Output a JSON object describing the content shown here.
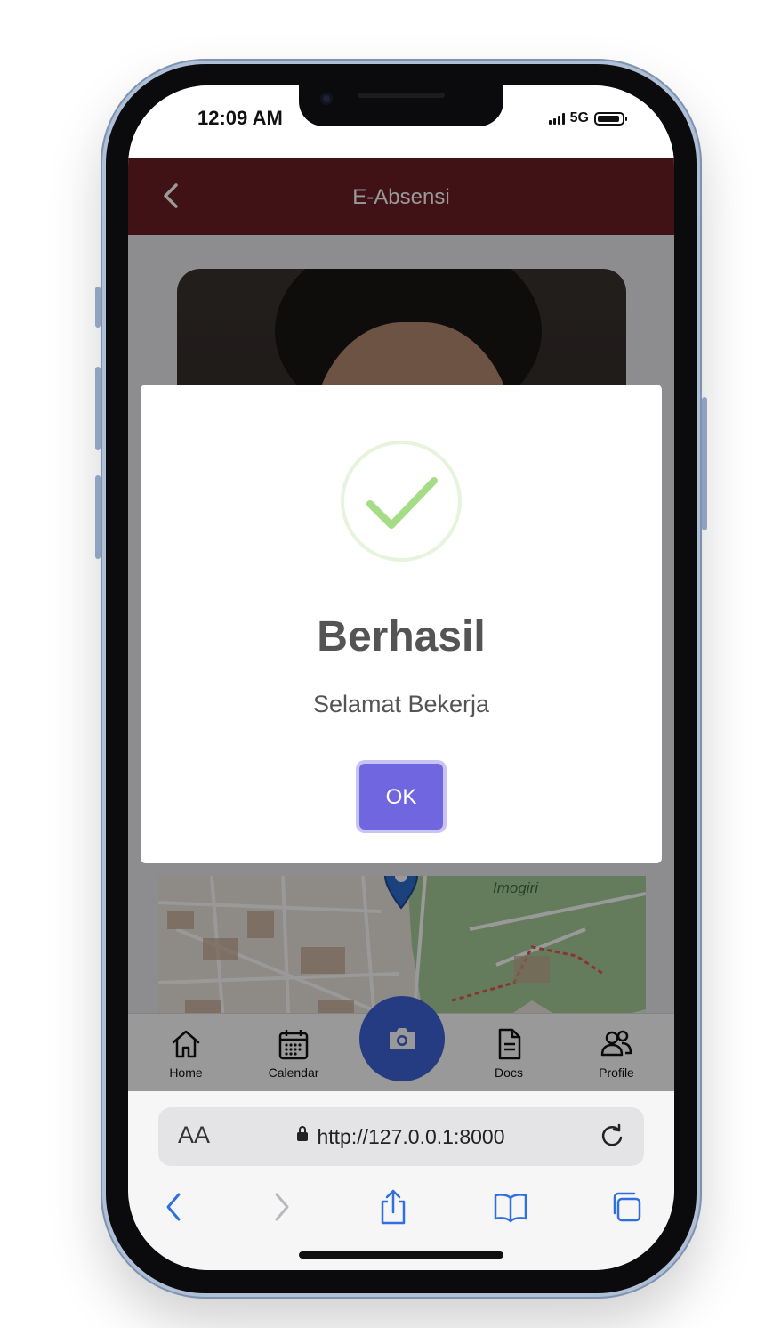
{
  "status_bar": {
    "time": "12:09 AM",
    "network": "5G"
  },
  "header": {
    "title": "E-Absensi",
    "back_icon": "chevron-left-icon"
  },
  "map": {
    "place_label": "Imogiri"
  },
  "modal": {
    "icon": "success-check-icon",
    "title": "Berhasil",
    "message": "Selamat Bekerja",
    "ok_label": "OK",
    "accent": "#7066e0",
    "check_color": "#a5dc86"
  },
  "bottom_nav": {
    "items": [
      {
        "label": "Home",
        "icon": "home-icon"
      },
      {
        "label": "Calendar",
        "icon": "calendar-icon"
      },
      {
        "label": "",
        "icon": "camera-icon"
      },
      {
        "label": "Docs",
        "icon": "document-icon"
      },
      {
        "label": "Profile",
        "icon": "users-icon"
      }
    ],
    "fab_color": "#3e64d9"
  },
  "browser": {
    "text_size_label": "AA",
    "url": "http://127.0.0.1:8000",
    "accent": "#2f6fe0"
  },
  "colors": {
    "header_bg": "#6b1f23"
  }
}
